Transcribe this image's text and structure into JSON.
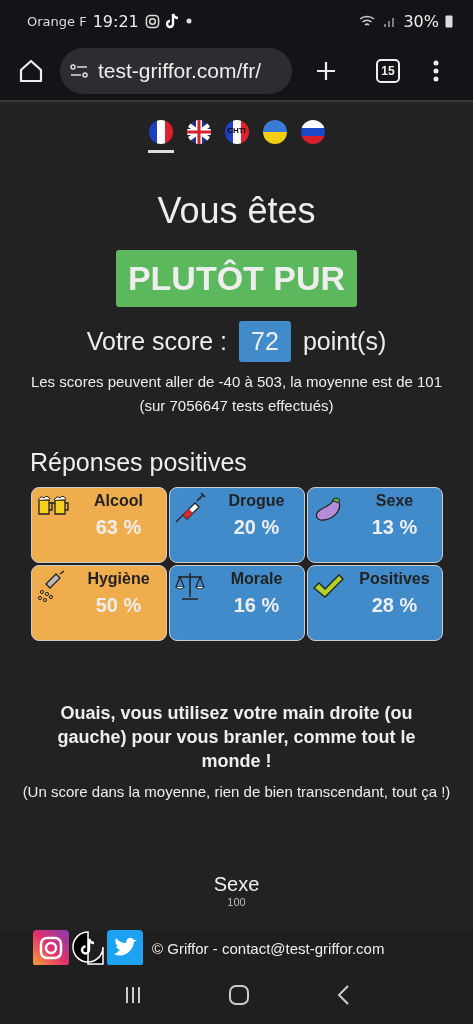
{
  "status_bar": {
    "carrier": "Orange F",
    "time": "19:21",
    "battery": "30%"
  },
  "browser": {
    "url": "test-griffor.com/fr/",
    "tab_count": "15"
  },
  "languages": [
    {
      "kind": "fr",
      "selected": true
    },
    {
      "kind": "gb",
      "selected": false
    },
    {
      "kind": "chti",
      "label": "CHTI",
      "selected": false
    },
    {
      "kind": "ua",
      "selected": false
    },
    {
      "kind": "ru",
      "selected": false
    }
  ],
  "heading": "Vous êtes",
  "verdict": "PLUTÔT PUR",
  "score": {
    "label": "Votre score :",
    "value": "72",
    "unit": "point(s)"
  },
  "score_note": "Les scores peuvent aller de -40 à 503, la moyenne est de 101 (sur 7056647 tests effectués)",
  "section_title": "Réponses positives",
  "categories": [
    {
      "kind": "beer",
      "name": "Alcool",
      "percent": "63 %",
      "color": "#f0ad4e"
    },
    {
      "kind": "syringe",
      "name": "Drogue",
      "percent": "20 %",
      "color": "#428bca"
    },
    {
      "kind": "eggplant",
      "name": "Sexe",
      "percent": "13 %",
      "color": "#428bca"
    },
    {
      "kind": "shower",
      "name": "Hygiène",
      "percent": "50 %",
      "color": "#f0ad4e"
    },
    {
      "kind": "scales",
      "name": "Morale",
      "percent": "16 %",
      "color": "#428bca"
    },
    {
      "kind": "check",
      "name": "Positives",
      "percent": "28 %",
      "color": "#428bca"
    }
  ],
  "message": "Ouais, vous utilisez votre main droite (ou gauche) pour vous branler, comme tout le monde !",
  "message_note": "(Un score dans la moyenne, rien de bien transcendant, tout ça !)",
  "gauge": {
    "title": "Sexe",
    "tick": "100"
  },
  "footer": {
    "text": "© Griffor - contact@test-griffor.com"
  }
}
